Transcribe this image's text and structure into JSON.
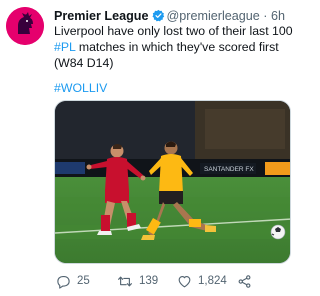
{
  "account": {
    "name": "Premier League",
    "handle": "@premierleague",
    "separator": "·",
    "time": "6h",
    "avatar_icon": "premier-league-lion-logo",
    "verified_icon": "verified-badge-icon"
  },
  "tweet": {
    "text_before": "Liverpool have only lost two of their last 100 ",
    "hashtag_pl": "#PL",
    "text_after": " matches in which they've scored first (W84 D14)",
    "tagline": "#WOLLIV"
  },
  "media": {
    "type": "photo",
    "description": "Liverpool player in red kit and Wolves player in gold kit competing for the ball",
    "board_text": "SANTANDER FX"
  },
  "actions": {
    "reply": {
      "icon": "reply-icon",
      "count": "25"
    },
    "retweet": {
      "icon": "retweet-icon",
      "count": "139"
    },
    "like": {
      "icon": "heart-icon",
      "count": "1,824"
    },
    "share": {
      "icon": "share-icon"
    }
  },
  "colors": {
    "accent": "#1d9bf0",
    "avatar_bg": "#e5006d",
    "text": "#0f1419",
    "muted": "#536471"
  }
}
